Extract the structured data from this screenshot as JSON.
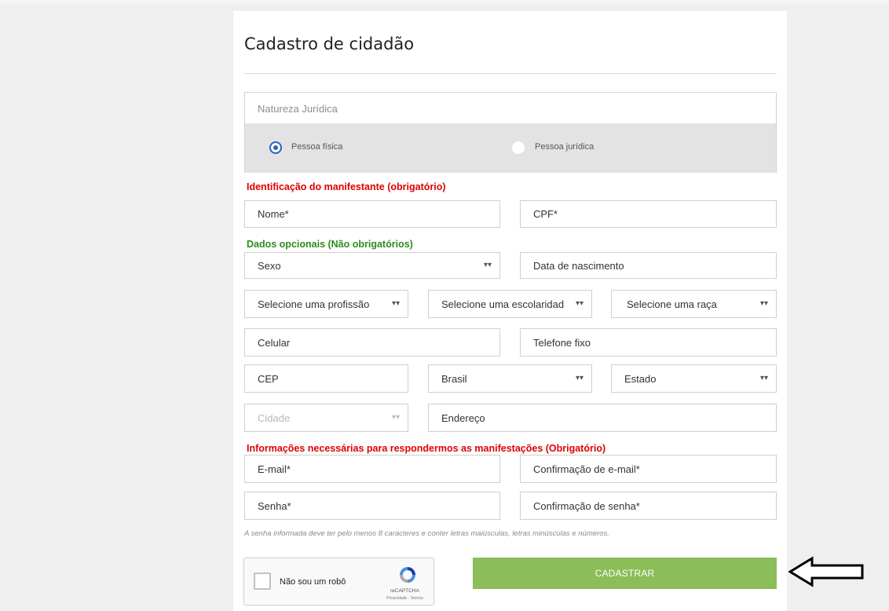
{
  "form": {
    "title": "Cadastro de cidadão",
    "natureza": {
      "label": "Natureza Jurídica",
      "options": [
        {
          "label": "Pessoa física",
          "selected": true
        },
        {
          "label": "Pessoa jurídica",
          "selected": false
        }
      ]
    },
    "sections": {
      "identificacao": "Identificação do manifestante (obrigatório)",
      "opcionais": "Dados opcionais (Não obrigatórios)",
      "necessarias": "Informações necessárias para respondermos as manifestações (Obrigatório)"
    },
    "fields": {
      "nome": "Nome*",
      "cpf": "CPF*",
      "sexo": "Sexo",
      "data_nascimento": "Data de nascimento",
      "profissao": "Selecione uma profissão",
      "escolaridade": "Selecione uma escolaridad",
      "raca": "Selecione uma raça",
      "celular": "Celular",
      "telefone": "Telefone fixo",
      "cep": "CEP",
      "pais": "Brasil",
      "estado": "Estado",
      "cidade": "Cidade",
      "endereco": "Endereço",
      "email": "E-mail*",
      "confirmacao_email": "Confirmação de e-mail*",
      "senha": "Senha*",
      "confirmacao_senha": "Confirmação de senha*"
    },
    "password_note": "A senha informada deve ter pelo menos 8 caracteres e conter letras maiúsculas, letras minúsculas e números.",
    "recaptcha": {
      "label": "Não sou um robô",
      "brand": "reCAPTCHA",
      "links": "Privacidade - Termos"
    },
    "submit_label": "CADASTRAR"
  },
  "colors": {
    "required_section": "#e00000",
    "optional_section": "#2e8b1f",
    "submit_bg": "#8bbd58",
    "radio_selected": "#2f5fbf"
  },
  "icons": {
    "select_chevron": "chevron-down-icon",
    "annotation": "arrow-left-icon"
  }
}
